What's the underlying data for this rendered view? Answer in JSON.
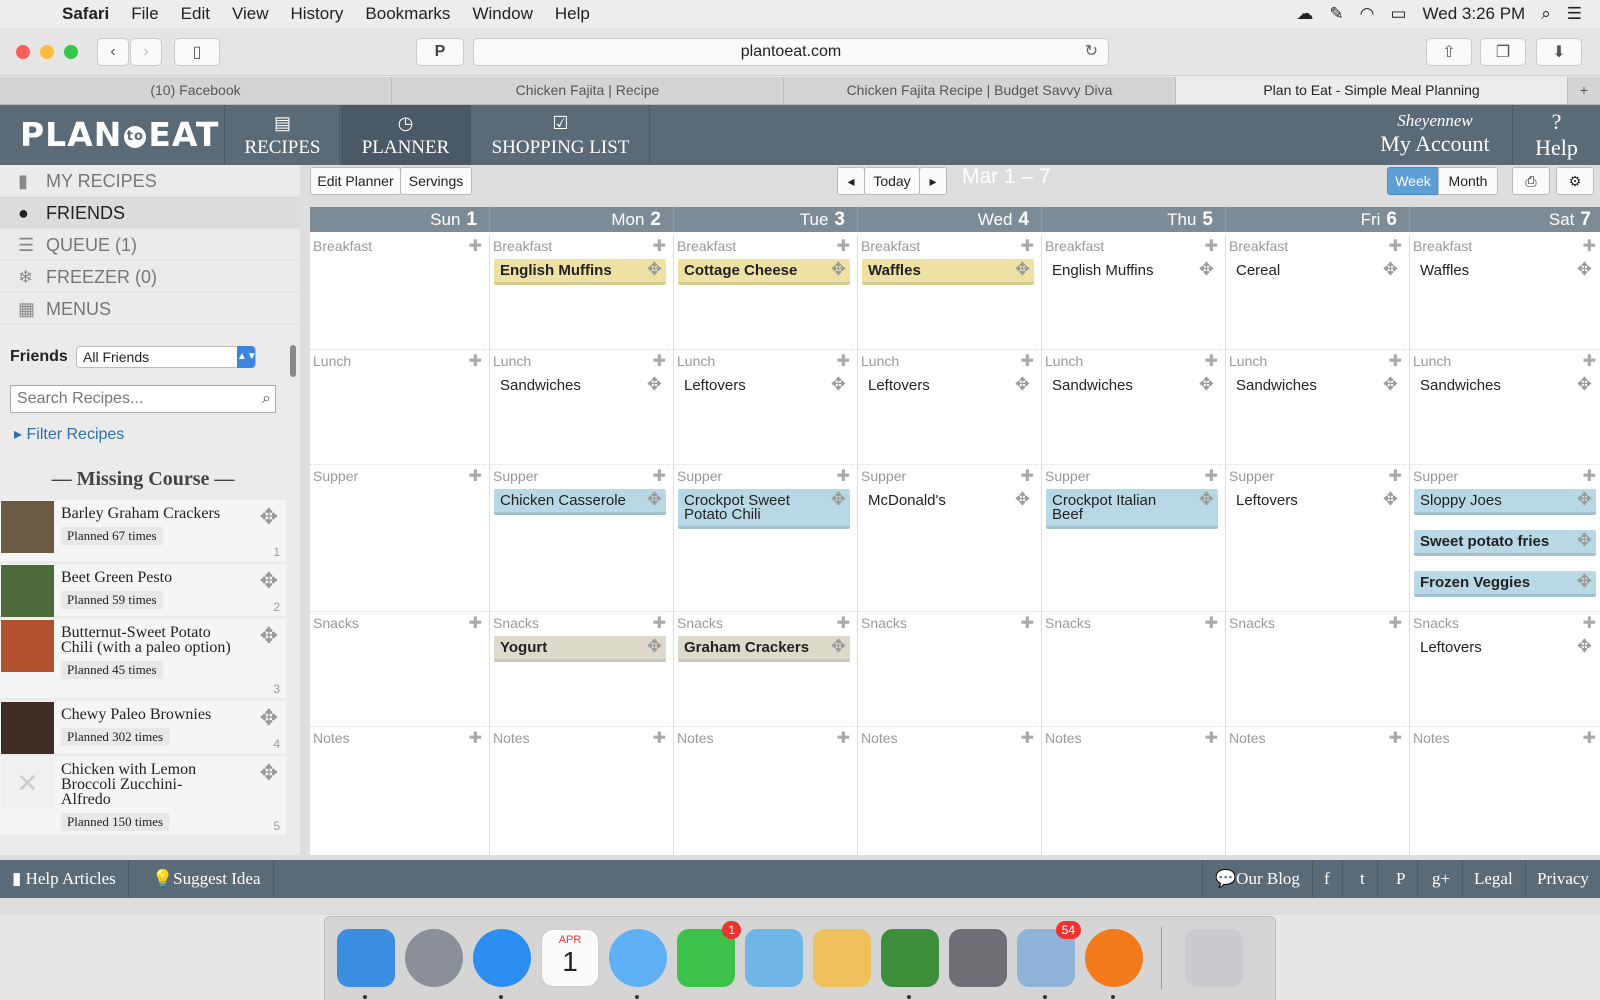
{
  "menubar": {
    "app": "Safari",
    "items": [
      "File",
      "Edit",
      "View",
      "History",
      "Bookmarks",
      "Window",
      "Help"
    ],
    "clock": "Wed 3:26 PM"
  },
  "browser": {
    "url": "plantoeat.com",
    "tabs": [
      "(10) Facebook",
      "Chicken Fajita | Recipe",
      "Chicken Fajita Recipe | Budget Savvy Diva",
      "Plan to Eat - Simple Meal Planning"
    ]
  },
  "header": {
    "logo_left": "PLAN",
    "logo_to": "to",
    "logo_right": "EAT",
    "nav": [
      "RECIPES",
      "PLANNER",
      "SHOPPING LIST"
    ],
    "username": "Sheyennew",
    "account": "My Account",
    "help_q": "?",
    "help": "Help"
  },
  "sidebar": {
    "nav": [
      "MY RECIPES",
      "FRIENDS",
      "QUEUE (1)",
      "FREEZER (0)",
      "MENUS"
    ],
    "friends_label": "Friends",
    "friends_select": "All Friends",
    "search_placeholder": "Search Recipes...",
    "filter": "Filter Recipes",
    "missing_course": "— Missing Course —",
    "recipes": [
      {
        "name": "Barley Graham Crackers",
        "planned": "Planned 67 times",
        "num": "1"
      },
      {
        "name": "Beet Green Pesto",
        "planned": "Planned 59 times",
        "num": "2"
      },
      {
        "name": "Butternut-Sweet Potato Chili (with a paleo option)",
        "planned": "Planned 45 times",
        "num": "3"
      },
      {
        "name": "Chewy Paleo Brownies",
        "planned": "Planned 302 times",
        "num": "4"
      },
      {
        "name": "Chicken with Lemon Broccoli Zucchini-Alfredo",
        "planned": "Planned 150 times",
        "num": "5"
      }
    ]
  },
  "planner": {
    "edit": "Edit Planner",
    "servings": "Servings",
    "today": "Today",
    "range": "Mar 1 – 7",
    "week": "Week",
    "month": "Month",
    "days": [
      {
        "name": "Sun",
        "num": "1"
      },
      {
        "name": "Mon",
        "num": "2"
      },
      {
        "name": "Tue",
        "num": "3"
      },
      {
        "name": "Wed",
        "num": "4"
      },
      {
        "name": "Thu",
        "num": "5"
      },
      {
        "name": "Fri",
        "num": "6"
      },
      {
        "name": "Sat",
        "num": "7"
      }
    ],
    "slots": [
      "Breakfast",
      "Lunch",
      "Supper",
      "Snacks",
      "Notes"
    ],
    "meals": [
      {
        "day": 1,
        "slot": 0,
        "text": "English Muffins",
        "style": "y"
      },
      {
        "day": 2,
        "slot": 0,
        "text": "Cottage Cheese",
        "style": "y"
      },
      {
        "day": 3,
        "slot": 0,
        "text": "Waffles",
        "style": "y"
      },
      {
        "day": 4,
        "slot": 0,
        "text": "English Muffins",
        "style": "n"
      },
      {
        "day": 5,
        "slot": 0,
        "text": "Cereal",
        "style": "n"
      },
      {
        "day": 6,
        "slot": 0,
        "text": "Waffles",
        "style": "n"
      },
      {
        "day": 1,
        "slot": 1,
        "text": "Sandwiches",
        "style": "n"
      },
      {
        "day": 2,
        "slot": 1,
        "text": "Leftovers",
        "style": "n"
      },
      {
        "day": 3,
        "slot": 1,
        "text": "Leftovers",
        "style": "n"
      },
      {
        "day": 4,
        "slot": 1,
        "text": "Sandwiches",
        "style": "n"
      },
      {
        "day": 5,
        "slot": 1,
        "text": "Sandwiches",
        "style": "n"
      },
      {
        "day": 6,
        "slot": 1,
        "text": "Sandwiches",
        "style": "n"
      },
      {
        "day": 1,
        "slot": 2,
        "text": "Chicken Casserole",
        "style": "b"
      },
      {
        "day": 2,
        "slot": 2,
        "text": "Crockpot Sweet Potato Chili",
        "style": "b"
      },
      {
        "day": 3,
        "slot": 2,
        "text": "McDonald's",
        "style": "n"
      },
      {
        "day": 4,
        "slot": 2,
        "text": "Crockpot Italian Beef",
        "style": "b"
      },
      {
        "day": 5,
        "slot": 2,
        "text": "Leftovers",
        "style": "n"
      },
      {
        "day": 6,
        "slot": 2,
        "text": "Sloppy Joes",
        "style": "b"
      },
      {
        "day": 6,
        "slot": 2,
        "text": "Sweet potato fries",
        "style": "bb"
      },
      {
        "day": 6,
        "slot": 2,
        "text": "Frozen Veggies",
        "style": "bb"
      },
      {
        "day": 1,
        "slot": 3,
        "text": "Yogurt",
        "style": "g"
      },
      {
        "day": 2,
        "slot": 3,
        "text": "Graham Crackers",
        "style": "g"
      },
      {
        "day": 6,
        "slot": 3,
        "text": "Leftovers",
        "style": "n"
      }
    ]
  },
  "footer": {
    "help": "Help Articles",
    "suggest": "Suggest Idea",
    "blog": "Our Blog",
    "legal": "Legal",
    "privacy": "Privacy"
  },
  "dock": {
    "calendar_month": "APR",
    "calendar_day": "1",
    "facetime_badge": "1",
    "mail_badge": "54"
  },
  "colors": {
    "header": "#5b6a77",
    "yellow": "#efe0a3",
    "blue": "#b7d8e4",
    "gray": "#dddacc",
    "week": "#5d9fd4"
  }
}
